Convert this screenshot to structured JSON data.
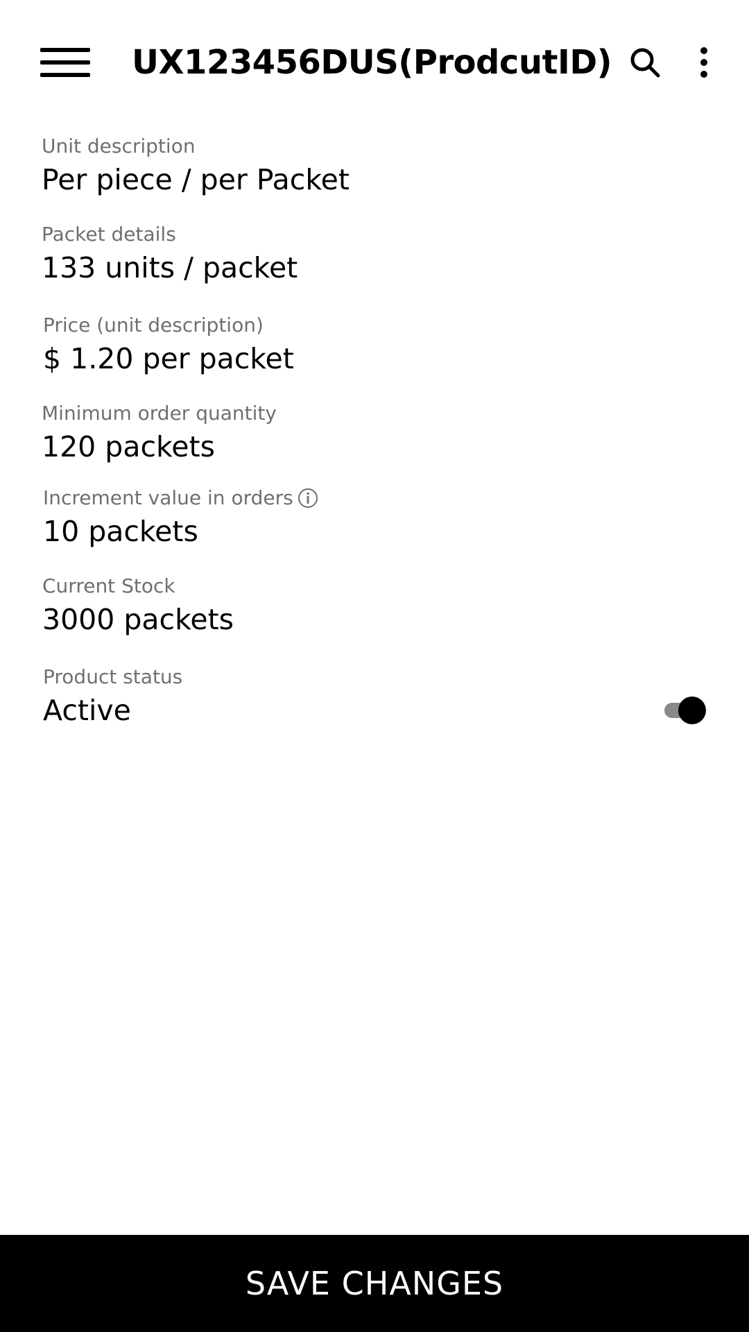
{
  "appbar": {
    "title": "UX123456DUS(ProdcutID)",
    "menu_icon": "hamburger-menu-icon",
    "search_icon": "search-icon",
    "more_icon": "more-vertical-icon"
  },
  "fields": {
    "unit_description": {
      "label": "Unit description",
      "value": "Per piece / per Packet"
    },
    "packet_details": {
      "label": "Packet details",
      "value": "133 units / packet"
    },
    "price": {
      "label": "Price (unit description)",
      "value": "$ 1.20 per packet"
    },
    "min_order": {
      "label": "Minimum order quantity",
      "value": "120 packets"
    },
    "increment": {
      "label": "Increment value in orders",
      "value": "10 packets",
      "icon": "info-icon"
    },
    "stock": {
      "label": "Current Stock",
      "value": "3000 packets"
    },
    "status": {
      "label": "Product status",
      "value": "Active",
      "toggle_on": true
    }
  },
  "footer": {
    "save_label": "SAVE CHANGES"
  },
  "colors": {
    "background": "#ffffff",
    "text": "#000000",
    "label": "#6f6f6f",
    "button_bg": "#000000",
    "button_text": "#ffffff",
    "toggle_track": "#8a8a8a",
    "toggle_thumb": "#000000"
  }
}
